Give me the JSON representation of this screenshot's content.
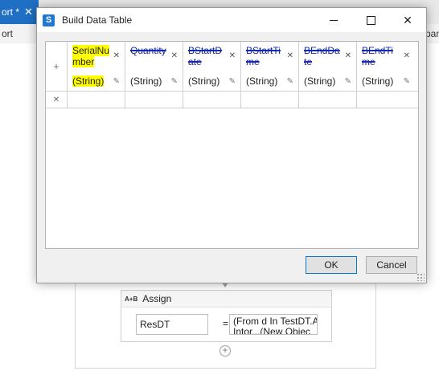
{
  "background": {
    "tab_label": "ort *",
    "tab_close": "✕",
    "strip_label": "ort",
    "right_label": "pan",
    "assign": {
      "icon_text": "A+B",
      "title": "Assign",
      "left_value": "ResDT",
      "equals": "=",
      "right_value": "(From d In TestDT.A\nIntor...(New Objec"
    },
    "add_symbol": "+"
  },
  "dialog": {
    "title": "Build Data Table",
    "icon_letter": "S",
    "controls": {
      "minimize": "—",
      "maximize": "☐",
      "close": "✕"
    },
    "grid": {
      "add_symbol": "+",
      "row_delete_symbol": "✕",
      "columns": [
        {
          "name": "SerialNumber",
          "type": "(String)",
          "highlighted": true,
          "redacted": false
        },
        {
          "name": "Quantity",
          "type": "(String)",
          "highlighted": false,
          "redacted": true
        },
        {
          "name": "BStartDate",
          "type": "(String)",
          "highlighted": false,
          "redacted": true
        },
        {
          "name": "BStartTime",
          "type": "(String)",
          "highlighted": false,
          "redacted": true
        },
        {
          "name": "BEndDate",
          "type": "(String)",
          "highlighted": false,
          "redacted": true
        },
        {
          "name": "BEndTime",
          "type": "(String)",
          "highlighted": false,
          "redacted": true
        }
      ],
      "column_close_symbol": "✕",
      "column_edit_symbol": "✎"
    },
    "buttons": {
      "ok": "OK",
      "cancel": "Cancel"
    }
  },
  "colors": {
    "highlight": "#ffff00",
    "redaction_ink": "#1428b4",
    "accent": "#1f78d1"
  }
}
